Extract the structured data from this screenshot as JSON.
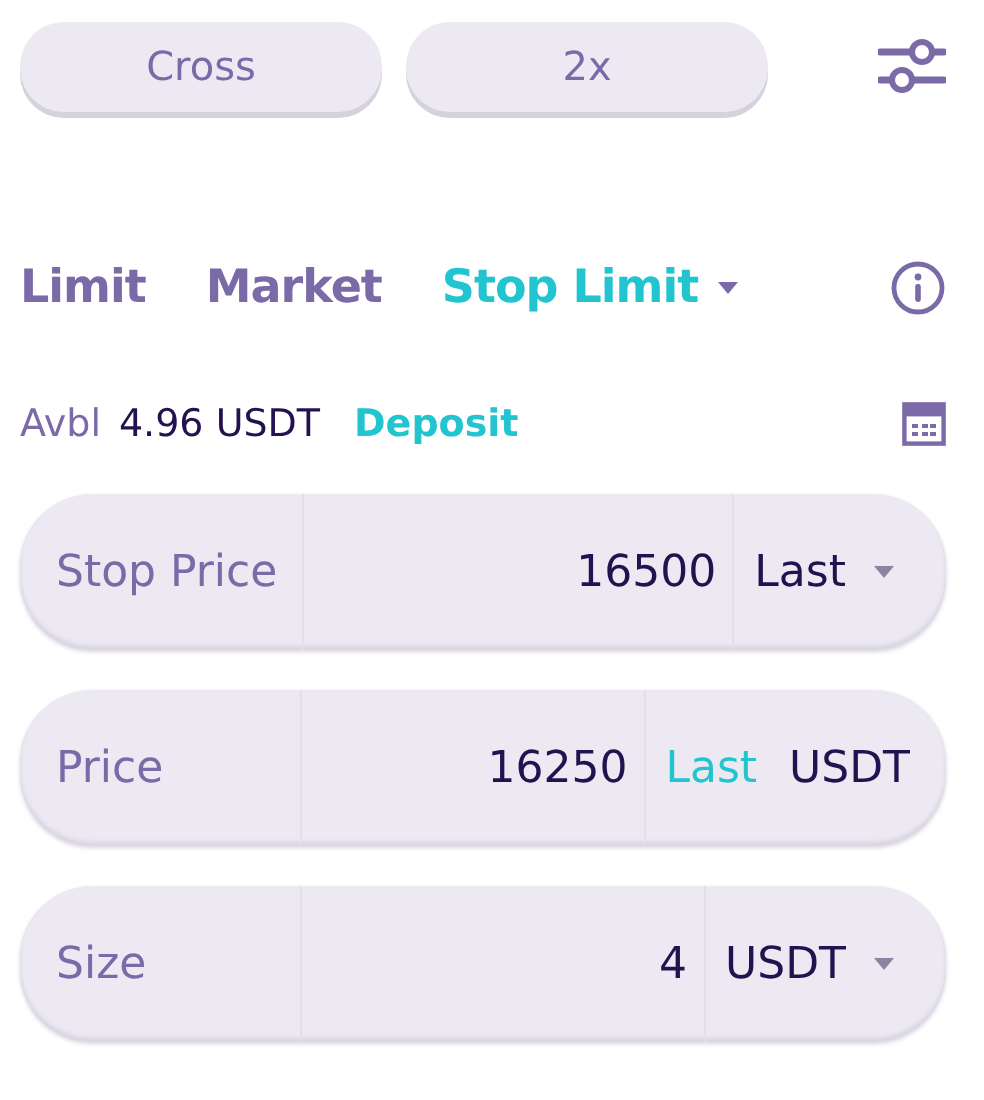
{
  "top_buttons": [
    {
      "label": "Cross"
    },
    {
      "label": "2x"
    }
  ],
  "order_tabs": [
    {
      "label": "Limit",
      "selected": false,
      "has_menu": false
    },
    {
      "label": "Market",
      "selected": false,
      "has_menu": false
    },
    {
      "label": "Stop Limit",
      "selected": true,
      "has_menu": true
    }
  ],
  "balance": {
    "label": "Avbl",
    "amount": "4.96 USDT",
    "link": "Deposit"
  },
  "fields": [
    {
      "label": "Stop Price",
      "value": "16500",
      "units": [
        {
          "text": "Last",
          "kind": "dropdown"
        }
      ]
    },
    {
      "label": "Price",
      "value": "16250",
      "units": [
        {
          "text": "Last",
          "kind": "link"
        },
        {
          "text": "USDT",
          "kind": "text"
        }
      ]
    },
    {
      "label": "Size",
      "value": "4",
      "units": [
        {
          "text": "USDT",
          "kind": "dropdown"
        }
      ]
    }
  ]
}
